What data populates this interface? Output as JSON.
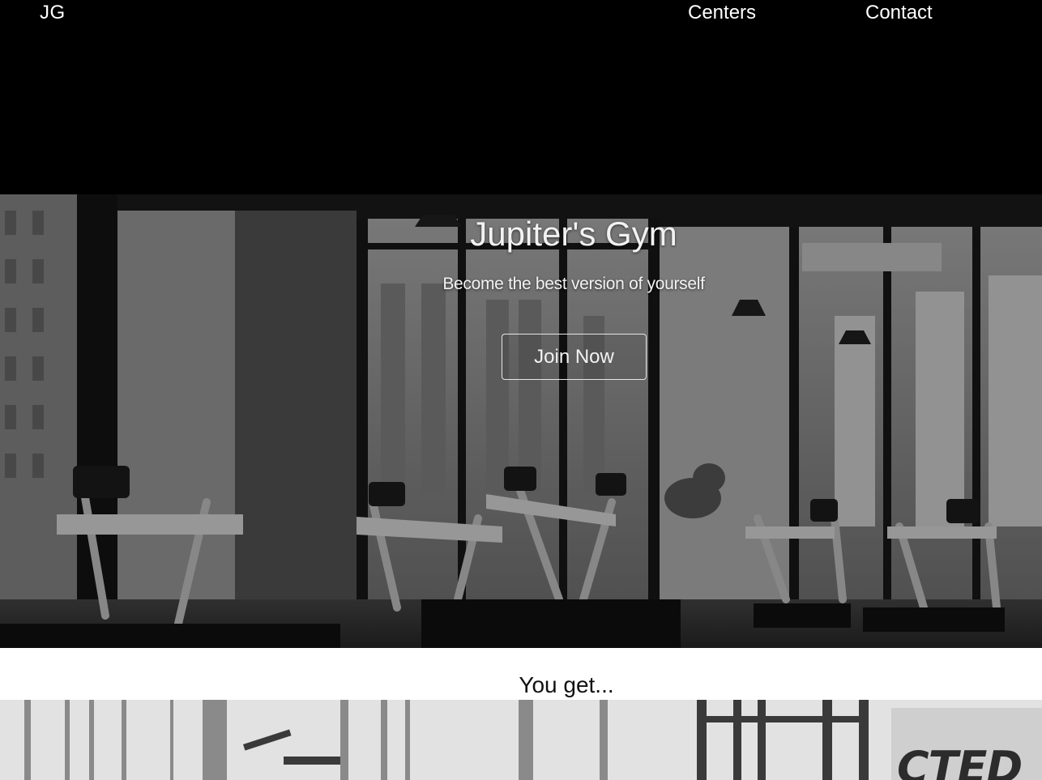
{
  "nav": {
    "logo": "JG",
    "links": [
      "Centers",
      "Contact"
    ]
  },
  "hero": {
    "title": "Jupiter's Gym",
    "subtitle": "Become the best version of yourself",
    "cta_label": "Join Now"
  },
  "section": {
    "heading": "You get..."
  },
  "strip": {
    "logo_fragment": "CTED"
  },
  "colors": {
    "topbar": "#000000",
    "text_light": "#f2f2f2",
    "page_bg": "#ffffff"
  }
}
